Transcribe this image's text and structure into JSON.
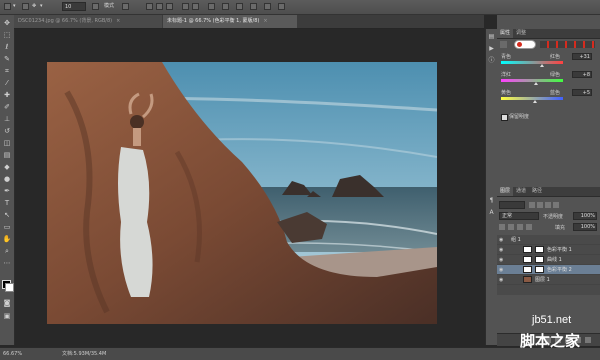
{
  "options_bar": {
    "items": [
      "Ps",
      "▾",
      "▭",
      "✥",
      "▾",
      "ℹ",
      "□",
      "▭",
      "▭",
      "▭",
      "▭",
      "▭",
      "▭"
    ],
    "mode_label": "模式",
    "value_label": "10"
  },
  "tabs": [
    {
      "label": "DSC01234.jpg @ 66.7% (背景, RGB/8)",
      "close": "×",
      "active": false
    },
    {
      "label": "未标题-1 @ 66.7% (色彩平衡 1, 蒙版/8)",
      "close": "×",
      "active": true
    }
  ],
  "panels": {
    "adjust_tabs": [
      "属性",
      "调整"
    ],
    "color_balance": {
      "sliders": [
        {
          "left": "青色",
          "right": "红色",
          "value": "+31"
        },
        {
          "left": "洋红",
          "right": "绿色",
          "value": "+8"
        },
        {
          "left": "黄色",
          "right": "蓝色",
          "value": "+5"
        }
      ],
      "preserve_label": "保留明度"
    },
    "layers_tabs": [
      "图层",
      "通道",
      "路径"
    ],
    "blend_mode": "正常",
    "opacity_label": "不透明度",
    "opacity_value": "100%",
    "fill_label": "填充",
    "fill_value": "100%",
    "layers": [
      {
        "name": "组 1",
        "selected": false
      },
      {
        "name": "色彩平衡 1",
        "selected": false
      },
      {
        "name": "曲线 1",
        "selected": false
      },
      {
        "name": "色彩平衡 2",
        "selected": true
      },
      {
        "name": "图层 1",
        "selected": false
      }
    ]
  },
  "status": {
    "zoom": "66.67%",
    "doc_info": "文档:5.93M/35.4M"
  },
  "watermark": {
    "site": "jb51.net",
    "name": "脚本之家"
  },
  "colors": {
    "accent_selected_layer": "#6b7f95",
    "logo_red": "#d52b1e",
    "foreground": "#000000",
    "background": "#ffffff"
  }
}
